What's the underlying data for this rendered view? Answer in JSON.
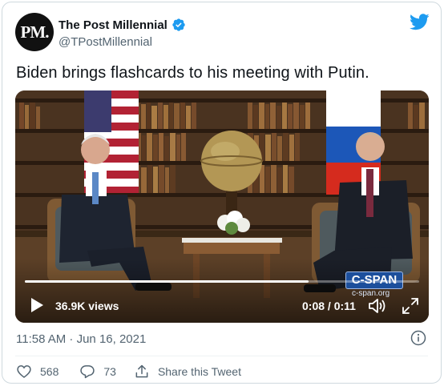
{
  "author": {
    "avatar_text": "PM.",
    "name": "The Post Millennial",
    "handle": "@TPostMillennial"
  },
  "tweet": {
    "text": "Biden brings flashcards to his meeting with Putin."
  },
  "video": {
    "views": "36.9K views",
    "time": "0:08 / 0:11",
    "progress_fraction": 0.72,
    "watermark": "C-SPAN",
    "watermark_url": "c-span.org"
  },
  "meta": {
    "timestamp": "11:58 AM · Jun 16, 2021"
  },
  "actions": {
    "likes": "568",
    "replies": "73",
    "share_label": "Share this Tweet"
  },
  "colors": {
    "accent": "#1d9bf0",
    "secondary_text": "#536471"
  },
  "icons": [
    "verified-badge-icon",
    "twitter-bird-icon",
    "play-icon",
    "volume-icon",
    "fullscreen-icon",
    "info-icon",
    "heart-icon",
    "reply-icon",
    "share-icon"
  ]
}
